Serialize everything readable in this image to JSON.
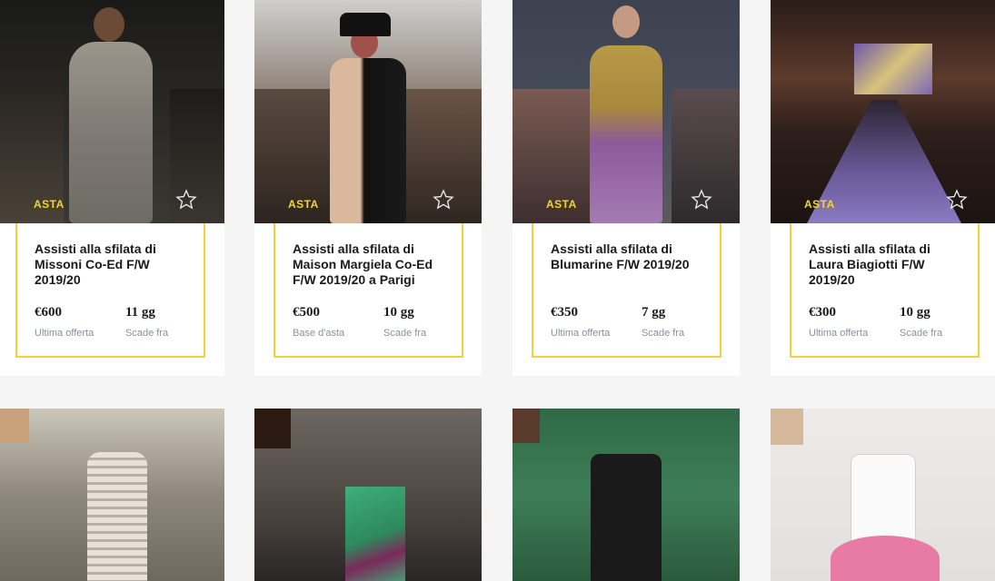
{
  "colors": {
    "accent": "#f2d23a",
    "page_bg": "#f5f5f5",
    "card_bg": "#ffffff",
    "label": "#8a8f9c"
  },
  "cards": [
    {
      "badge": "ASTA",
      "title": "Assisti alla sfilata di Missoni Co-Ed F/W 2019/20",
      "price": "€600",
      "price_label": "Ultima offerta",
      "days": "11 gg",
      "days_label": "Scade fra",
      "icon": "star-icon"
    },
    {
      "badge": "ASTA",
      "title": "Assisti alla sfilata di Maison Margiela Co-Ed F/W 2019/20 a Parigi",
      "price": "€500",
      "price_label": "Base d'asta",
      "days": "10 gg",
      "days_label": "Scade fra",
      "icon": "star-icon"
    },
    {
      "badge": "ASTA",
      "title": "Assisti alla sfilata di Blumarine F/W 2019/20",
      "price": "€350",
      "price_label": "Ultima offerta",
      "days": "7 gg",
      "days_label": "Scade fra",
      "icon": "star-icon"
    },
    {
      "badge": "ASTA",
      "title": "Assisti alla sfilata di Laura Biagiotti F/W 2019/20",
      "price": "€300",
      "price_label": "Ultima offerta",
      "days": "10 gg",
      "days_label": "Scade fra",
      "icon": "star-icon"
    }
  ]
}
